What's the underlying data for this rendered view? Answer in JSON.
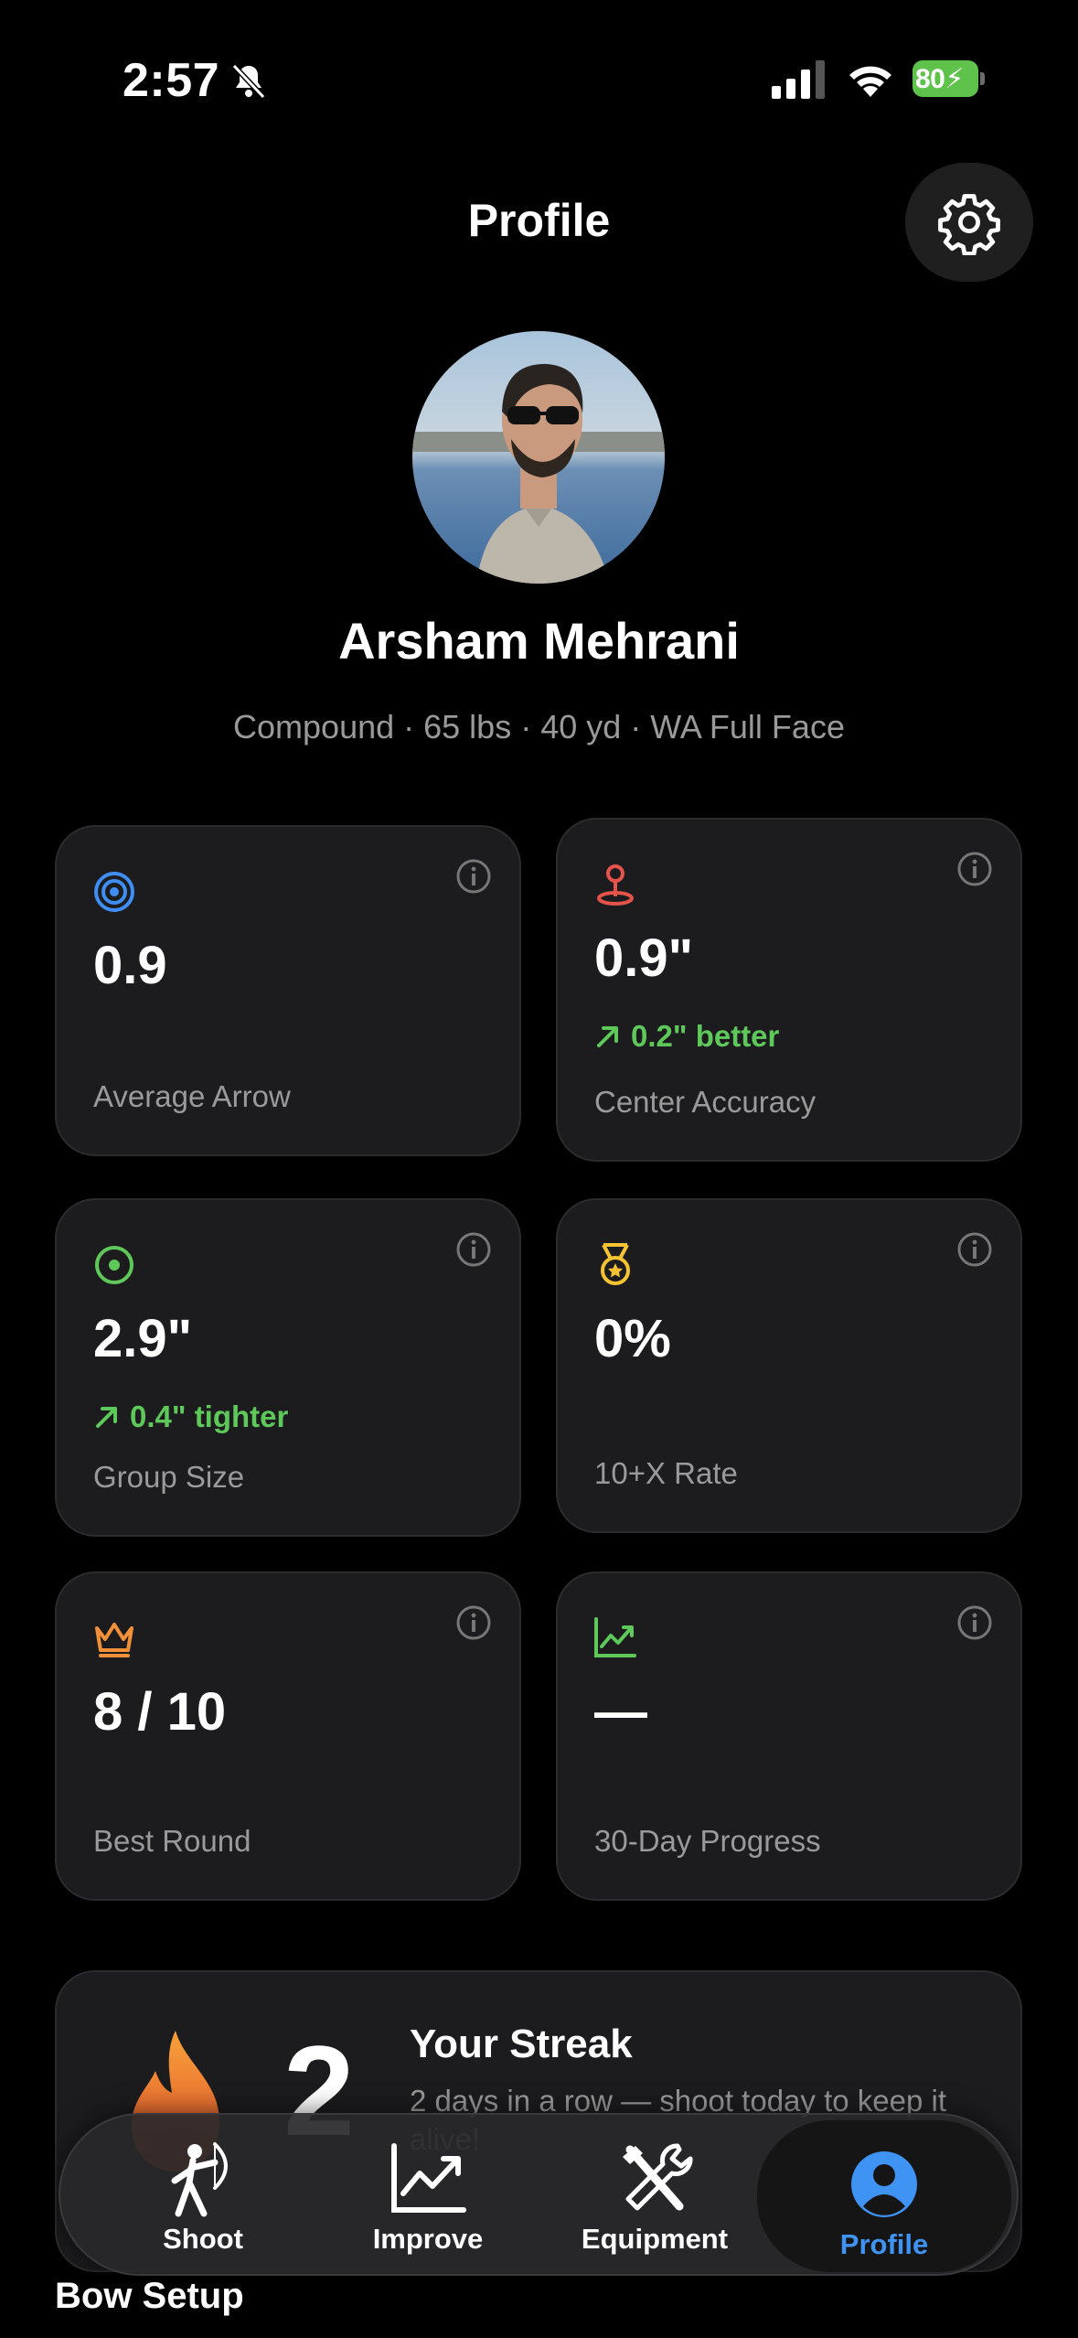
{
  "status_bar": {
    "time": "2:57",
    "battery": "80"
  },
  "header": {
    "title": "Profile"
  },
  "user": {
    "name": "Arsham Mehrani",
    "meta": "Compound · 65 lbs · 40 yd · WA Full Face"
  },
  "stats": [
    {
      "icon": "target-icon",
      "value": "0.9",
      "delta": "",
      "label": "Average Arrow",
      "color": "#3f8ef3"
    },
    {
      "icon": "pin-icon",
      "value": "0.9\"",
      "delta": "0.2\" better",
      "label": "Center Accuracy",
      "color": "#e5534b"
    },
    {
      "icon": "scope-icon",
      "value": "2.9\"",
      "delta": "0.4\" tighter",
      "label": "Group Size",
      "color": "#5ec95a"
    },
    {
      "icon": "medal-icon",
      "value": "0%",
      "delta": "",
      "label": "10+X Rate",
      "color": "#f5c331"
    },
    {
      "icon": "crown-icon",
      "value": "8 / 10",
      "delta": "",
      "label": "Best Round",
      "color": "#f0913a"
    },
    {
      "icon": "trend-icon",
      "value": "—",
      "delta": "",
      "label": "30-Day Progress",
      "color": "#5ec95a"
    }
  ],
  "streak": {
    "count": "2",
    "title": "Your Streak",
    "subtitle": "2 days in a row — shoot today to keep it alive!"
  },
  "tabs": [
    {
      "label": "Shoot",
      "active": false
    },
    {
      "label": "Improve",
      "active": false
    },
    {
      "label": "Equipment",
      "active": false
    },
    {
      "label": "Profile",
      "active": true
    }
  ],
  "next_section": "Bow Setup",
  "colors": {
    "accent": "#3f93f3",
    "positive": "#5ec95a",
    "card": "#1c1c1e"
  }
}
